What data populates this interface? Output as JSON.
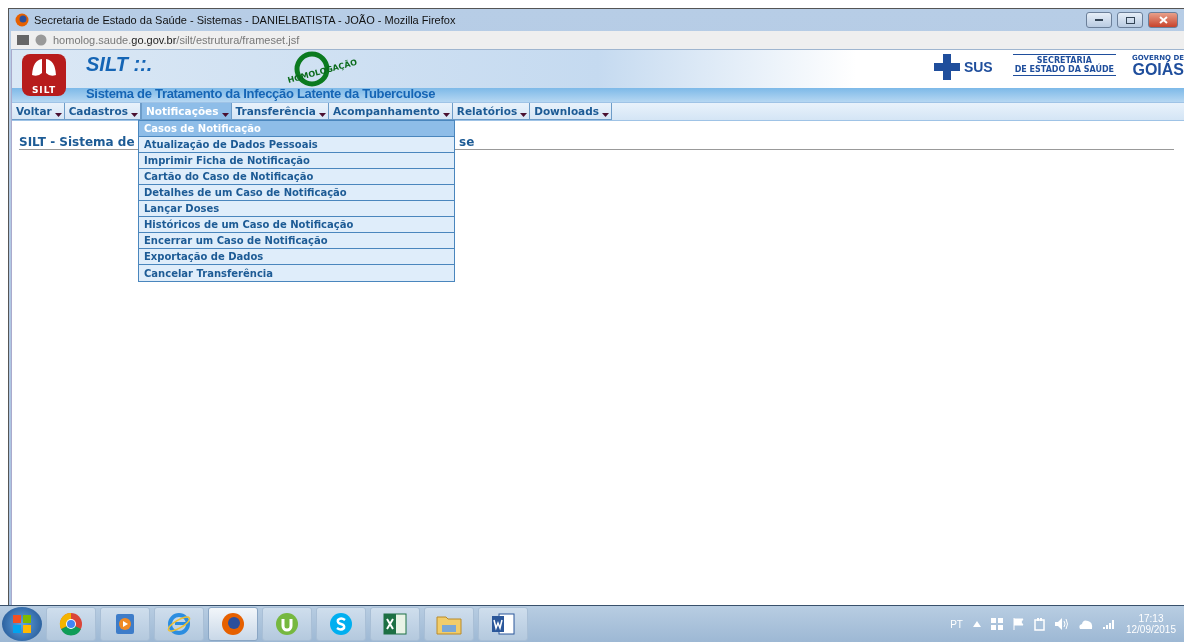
{
  "window": {
    "title": "Secretaria de Estado da Saúde - Sistemas - DANIELBATISTA - JOÃO - Mozilla Firefox"
  },
  "address": {
    "prefix": "homolog.saude.",
    "domain": "go.gov.br",
    "path": "/silt/estrutura/frameset.jsf"
  },
  "banner": {
    "logo_label": "SILT",
    "app_name": "SILT ::.",
    "subtitle": "Sistema de Tratamento da Infecção Latente da Tuberculose",
    "stamp": "HOMOLOGAÇÃO",
    "sus": "SUS",
    "secretaria_1": "SECRETARIA",
    "secretaria_2": "DE ESTADO DA SAÚDE",
    "governo_1": "GOVERNO DE",
    "governo_2": "GOIÁS"
  },
  "menu": [
    {
      "label": "Voltar",
      "selected": false
    },
    {
      "label": "Cadastros",
      "selected": false
    },
    {
      "label": "Notificações",
      "selected": true
    },
    {
      "label": "Transferência",
      "selected": false
    },
    {
      "label": "Acompanhamento",
      "selected": false
    },
    {
      "label": "Relatórios",
      "selected": false
    },
    {
      "label": "Downloads",
      "selected": false
    }
  ],
  "dropdown": [
    {
      "label": "Casos de Notificação",
      "selected": true
    },
    {
      "label": "Atualização de Dados Pessoais",
      "selected": false
    },
    {
      "label": "Imprimir Ficha de Notificação",
      "selected": false
    },
    {
      "label": "Cartão do Caso de Notificação",
      "selected": false
    },
    {
      "label": "Detalhes de um Caso de Notificação",
      "selected": false
    },
    {
      "label": "Lançar Doses",
      "selected": false
    },
    {
      "label": "Históricos de um Caso de Notificação",
      "selected": false
    },
    {
      "label": "Encerrar um Caso de Notificação",
      "selected": false
    },
    {
      "label": "Exportação de Dados",
      "selected": false
    },
    {
      "label": "Cancelar Transferência",
      "selected": false
    }
  ],
  "heading": {
    "visible_start": "SILT - Sistema de",
    "visible_end": "se"
  },
  "taskbar": {
    "apps": [
      {
        "kind": "chrome",
        "selected": false
      },
      {
        "kind": "media",
        "selected": false
      },
      {
        "kind": "ie",
        "selected": false
      },
      {
        "kind": "firefox",
        "selected": true
      },
      {
        "kind": "torrent",
        "selected": false
      },
      {
        "kind": "skype",
        "selected": false
      },
      {
        "kind": "excel",
        "selected": false
      },
      {
        "kind": "folder",
        "selected": false
      },
      {
        "kind": "word",
        "selected": false
      }
    ],
    "language": "PT",
    "time": "17:13",
    "date": "12/09/2015"
  }
}
